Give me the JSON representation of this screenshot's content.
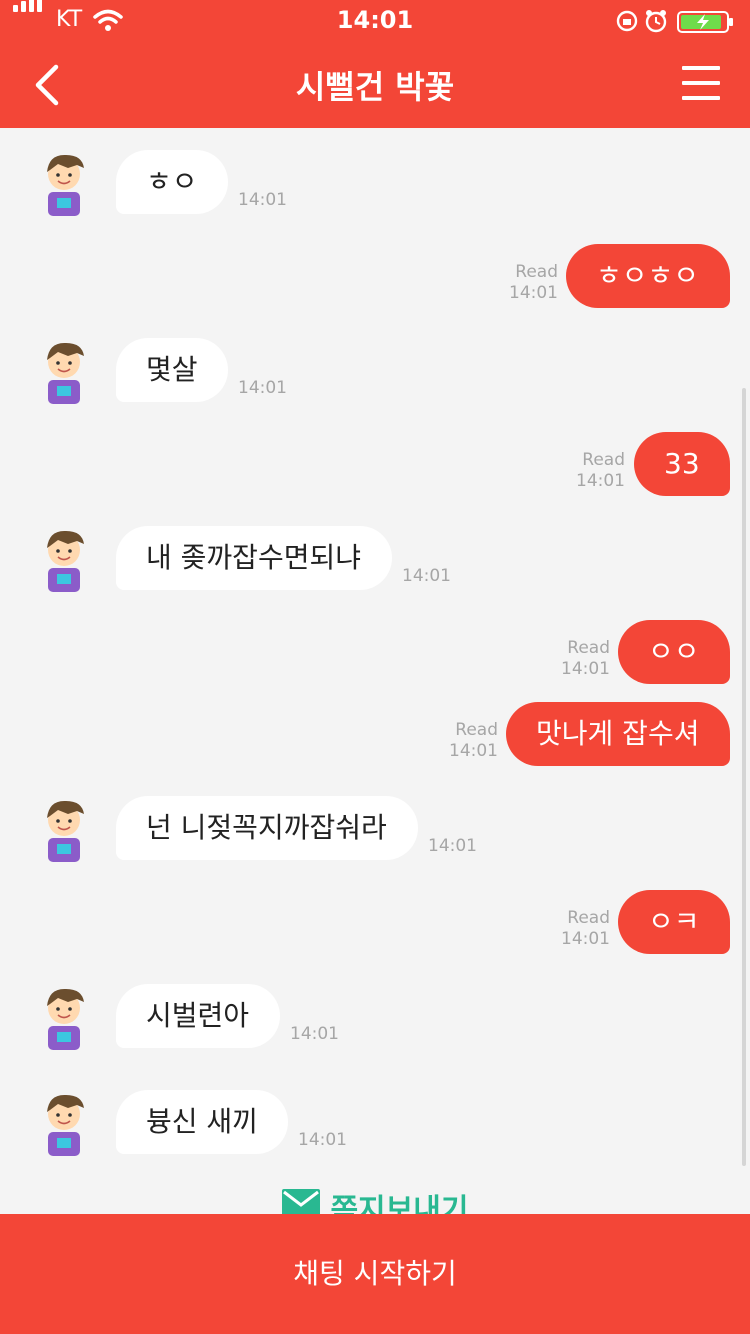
{
  "status_bar": {
    "carrier": "KT",
    "time": "14:01"
  },
  "header": {
    "title": "시뻘건 박꽃"
  },
  "messages": [
    {
      "dir": "in",
      "text": "ㅎㅇ",
      "time": "14:01"
    },
    {
      "dir": "out",
      "text": "ㅎㅇㅎㅇ",
      "read": "Read",
      "time": "14:01"
    },
    {
      "dir": "in",
      "text": "몇살",
      "time": "14:01"
    },
    {
      "dir": "out",
      "text": "33",
      "read": "Read",
      "time": "14:01"
    },
    {
      "dir": "in",
      "text": "내 좆까잡수면되냐",
      "time": "14:01"
    },
    {
      "dir": "out",
      "text": "ㅇㅇ",
      "read": "Read",
      "time": "14:01"
    },
    {
      "dir": "out",
      "text": "맛나게 잡수셔",
      "read": "Read",
      "time": "14:01"
    },
    {
      "dir": "in",
      "text": "넌 니젖꼭지까잡숴라",
      "time": "14:01"
    },
    {
      "dir": "out",
      "text": "ㅇㅋ",
      "read": "Read",
      "time": "14:01"
    },
    {
      "dir": "in",
      "text": "시벌련아",
      "time": "14:01"
    },
    {
      "dir": "in",
      "text": "븅신 새끼",
      "time": "14:01"
    }
  ],
  "footer": {
    "message_link": "쪽지보내기",
    "start_chat": "채팅 시작하기"
  },
  "colors": {
    "accent": "#f34637",
    "link": "#29b891",
    "background": "#f4f4f4"
  }
}
